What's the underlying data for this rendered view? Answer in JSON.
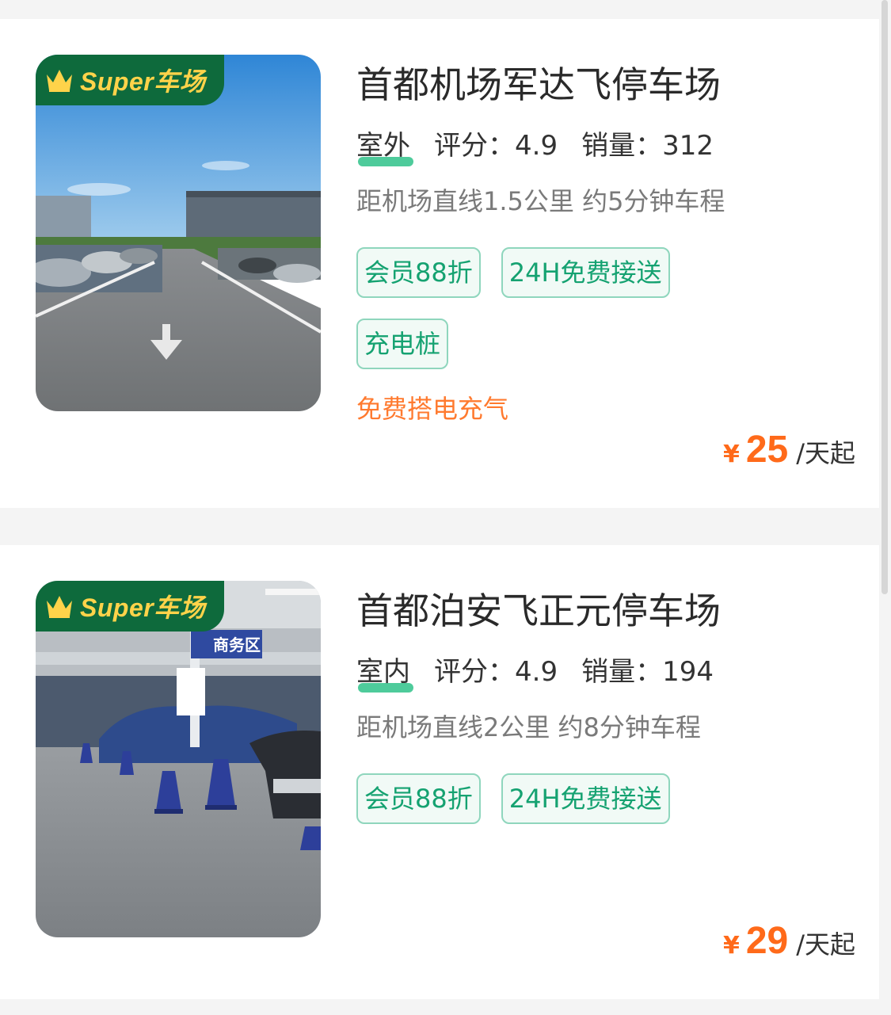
{
  "badge_text": "Super车场",
  "currency_symbol": "¥",
  "lots": [
    {
      "name": "首都机场军达飞停车场",
      "environment": "室外",
      "rating_label": "评分：",
      "rating": "4.9",
      "sales_label": "销量：",
      "sales": "312",
      "distance": "距机场直线1.5公里 约5分钟车程",
      "tags": [
        "会员88折",
        "24H免费接送",
        "充电桩"
      ],
      "service": "免费搭电充气",
      "price": "25",
      "price_unit": "/天起"
    },
    {
      "name": "首都泊安飞正元停车场",
      "environment": "室内",
      "rating_label": "评分：",
      "rating": "4.9",
      "sales_label": "销量：",
      "sales": "194",
      "distance": "距机场直线2公里 约8分钟车程",
      "tags": [
        "会员88折",
        "24H免费接送"
      ],
      "price": "29",
      "price_unit": "/天起",
      "photo_sign": "商务区"
    }
  ],
  "colors": {
    "accent_green": "#15a271",
    "badge_green": "#0e6a3c",
    "price_orange": "#ff6a1a",
    "service_orange": "#ff7a2f"
  }
}
